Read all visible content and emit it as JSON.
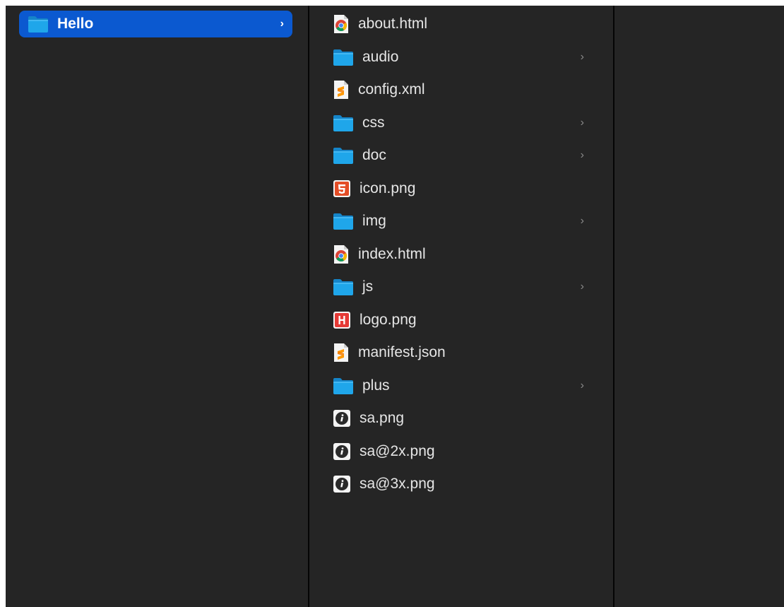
{
  "window": {
    "columns": [
      {
        "items": [
          {
            "label": "Hello",
            "type": "folder",
            "icon": "folder-icon",
            "selected": true,
            "has_children": true
          }
        ]
      },
      {
        "items": [
          {
            "label": "about.html",
            "type": "file",
            "icon": "chrome-html-icon",
            "has_children": false
          },
          {
            "label": "audio",
            "type": "folder",
            "icon": "folder-icon",
            "has_children": true
          },
          {
            "label": "config.xml",
            "type": "file",
            "icon": "sublime-file-icon",
            "has_children": false
          },
          {
            "label": "css",
            "type": "folder",
            "icon": "folder-icon",
            "has_children": true
          },
          {
            "label": "doc",
            "type": "folder",
            "icon": "folder-icon",
            "has_children": true
          },
          {
            "label": "icon.png",
            "type": "file",
            "icon": "html5-icon",
            "has_children": false
          },
          {
            "label": "img",
            "type": "folder",
            "icon": "folder-icon",
            "has_children": true
          },
          {
            "label": "index.html",
            "type": "file",
            "icon": "chrome-html-icon",
            "has_children": false
          },
          {
            "label": "js",
            "type": "folder",
            "icon": "folder-icon",
            "has_children": true
          },
          {
            "label": "logo.png",
            "type": "file",
            "icon": "hbuilder-icon",
            "has_children": false
          },
          {
            "label": "manifest.json",
            "type": "file",
            "icon": "sublime-file-icon",
            "has_children": false
          },
          {
            "label": "plus",
            "type": "folder",
            "icon": "folder-icon",
            "has_children": true
          },
          {
            "label": "sa.png",
            "type": "file",
            "icon": "info-image-icon",
            "has_children": false
          },
          {
            "label": "sa@2x.png",
            "type": "file",
            "icon": "info-image-icon",
            "has_children": false
          },
          {
            "label": "sa@3x.png",
            "type": "file",
            "icon": "info-image-icon",
            "has_children": false
          }
        ]
      },
      {
        "items": []
      }
    ],
    "chevron_glyph": "›",
    "colors": {
      "background": "#252525",
      "selection": "#0b59d0",
      "text": "#e6e6e6",
      "folder": "#1fa6ea",
      "divider": "#050505"
    }
  }
}
